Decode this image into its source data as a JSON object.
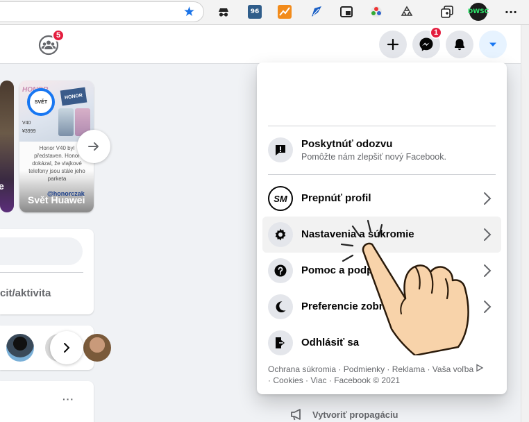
{
  "browser": {
    "extensions": [
      "spy-icon",
      "counter-extension-icon",
      "chart-extension-icon",
      "pen-extension-icon",
      "pip-extension-icon",
      "color-extension-icon",
      "recycle-extension-icon"
    ],
    "extension_counter": "96",
    "profile_label": "DWSC"
  },
  "header": {
    "groups_badge": "5",
    "messenger_badge": "1"
  },
  "stories": [
    {
      "name": "e"
    },
    {
      "name": "Svět Huawei",
      "brand": "HONOR",
      "avatar_label": "SVĚT",
      "price": "¥3999",
      "model": "V40",
      "headline": "Honor V40 byl představen. Honor dokázal, že vlajkové telefony jsou stále jeho parketa",
      "handle": "@honorczak"
    }
  ],
  "left": {
    "activity_label": "cit/aktivita"
  },
  "menu": {
    "feedback": {
      "label": "Poskytnúť odozvu",
      "sub": "Pomôžte nám zlepšiť nový Facebook."
    },
    "items": [
      {
        "label": "Prepnúť profil"
      },
      {
        "label": "Nastavenia a súkromie"
      },
      {
        "label": "Pomoc a podpora"
      },
      {
        "label": "Preferencie zobrazenia"
      },
      {
        "label": "Odhlásiť sa"
      }
    ],
    "footer": [
      "Ochrana súkromia",
      "Podmienky",
      "Reklama",
      "Vaša voľba",
      "Cookies",
      "Viac",
      "Facebook © 2021"
    ],
    "profile_monogram": "SM"
  },
  "right": {
    "create_ad": "Vytvoriť propagáciu"
  },
  "more_label": "···"
}
